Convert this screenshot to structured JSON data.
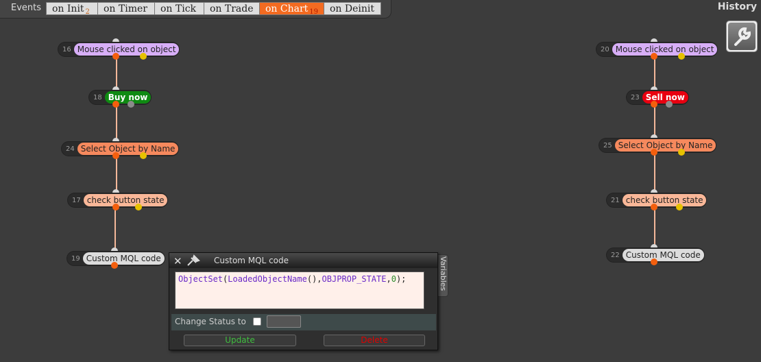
{
  "header": {
    "events_label": "Events",
    "history_label": "History",
    "tabs": [
      {
        "label": "on Init",
        "badge": "2"
      },
      {
        "label": "on Timer",
        "badge": ""
      },
      {
        "label": "on Tick",
        "badge": ""
      },
      {
        "label": "on Trade",
        "badge": ""
      },
      {
        "label": "on Chart",
        "badge": "19",
        "active": true
      },
      {
        "label": "on Deinit",
        "badge": ""
      }
    ]
  },
  "tool_button": {
    "icon": "wrench-icon"
  },
  "nodes": {
    "n16": {
      "id": "16",
      "label": "Mouse clicked on object"
    },
    "n18": {
      "id": "18",
      "label": "Buy now"
    },
    "n24": {
      "id": "24",
      "label": "Select Object by Name"
    },
    "n17": {
      "id": "17",
      "label": "check button state"
    },
    "n19": {
      "id": "19",
      "label": "Custom MQL code"
    },
    "n20": {
      "id": "20",
      "label": "Mouse clicked on object"
    },
    "n23": {
      "id": "23",
      "label": "Sell now"
    },
    "n25": {
      "id": "25",
      "label": "Select Object by Name"
    },
    "n21": {
      "id": "21",
      "label": "check button state"
    },
    "n22": {
      "id": "22",
      "label": "Custom MQL code"
    }
  },
  "popup": {
    "title": "Custom MQL code",
    "code_tokens": {
      "t1": "ObjectSet",
      "t2": "(",
      "t3": "LoadedObjectName",
      "t4": "(),",
      "t5": "OBJPROP_STATE",
      "t6": ",",
      "t7": "0",
      "t8": ");"
    },
    "status_label": "Change Status to",
    "update_label": "Update",
    "delete_label": "Delete",
    "variables_label": "Variables"
  },
  "colors": {
    "accent": "#f36b21",
    "buy": "#0f8a12",
    "sell": "#e80010",
    "event_node": "#d7aef7"
  }
}
